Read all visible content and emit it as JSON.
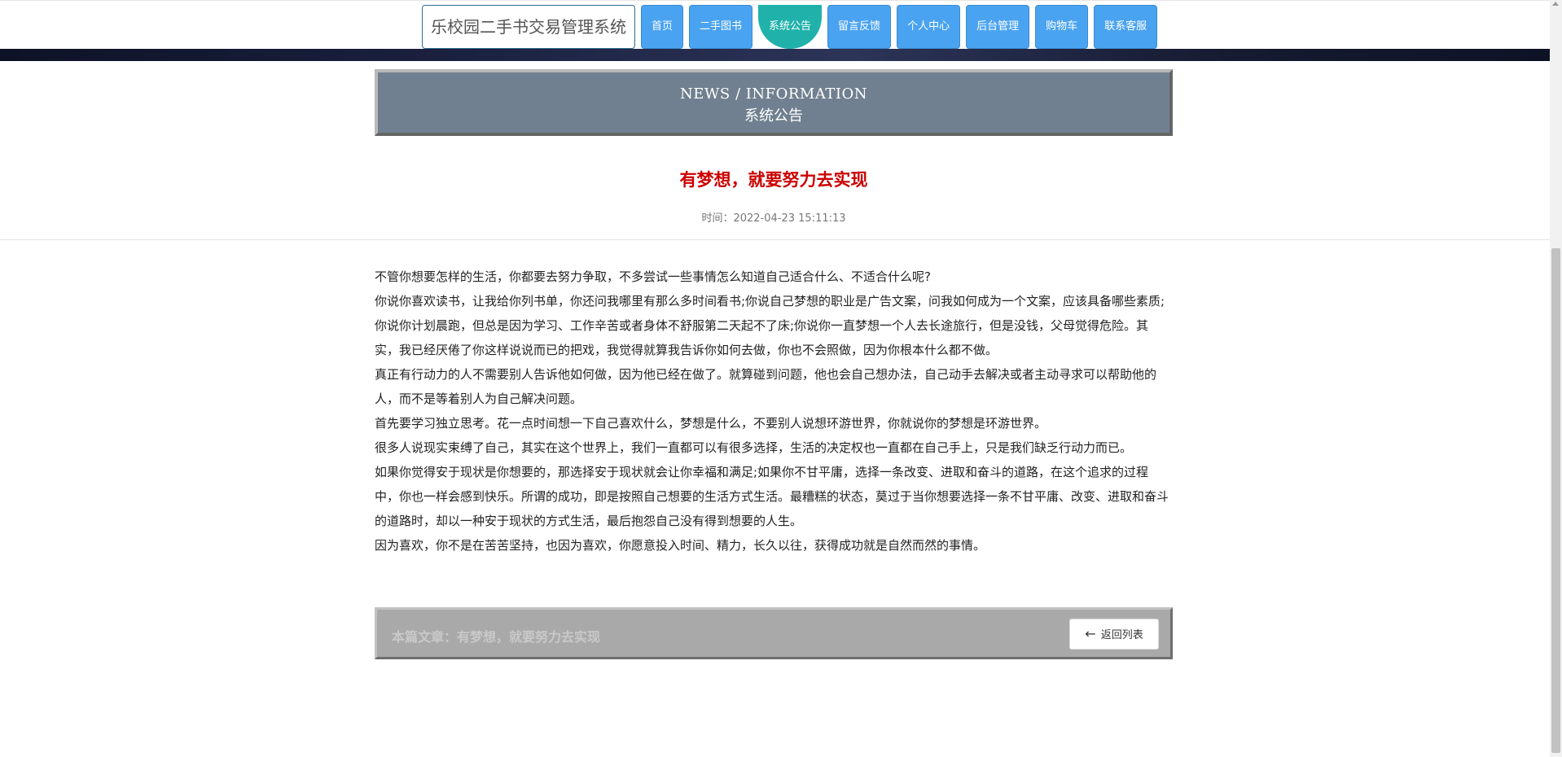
{
  "header": {
    "brand": "乐校园二手书交易管理系统",
    "nav": [
      {
        "label": "首页",
        "active": false
      },
      {
        "label": "二手图书",
        "active": false
      },
      {
        "label": "系统公告",
        "active": true
      },
      {
        "label": "留言反馈",
        "active": false
      },
      {
        "label": "个人中心",
        "active": false
      },
      {
        "label": "后台管理",
        "active": false
      },
      {
        "label": "购物车",
        "active": false
      },
      {
        "label": "联系客服",
        "active": false
      }
    ]
  },
  "banner": {
    "en": "NEWS / INFORMATION",
    "zh": "系统公告"
  },
  "article": {
    "title": "有梦想，就要努力去实现",
    "time_label": "时间：",
    "time": "2022-04-23 15:11:13",
    "paragraphs": [
      "不管你想要怎样的生活，你都要去努力争取，不多尝试一些事情怎么知道自己适合什么、不适合什么呢?",
      "你说你喜欢读书，让我给你列书单，你还问我哪里有那么多时间看书;你说自己梦想的职业是广告文案，问我如何成为一个文案，应该具备哪些素质;你说你计划晨跑，但总是因为学习、工作辛苦或者身体不舒服第二天起不了床;你说你一直梦想一个人去长途旅行，但是没钱，父母觉得危险。其实，我已经厌倦了你这样说说而已的把戏，我觉得就算我告诉你如何去做，你也不会照做，因为你根本什么都不做。",
      "真正有行动力的人不需要别人告诉他如何做，因为他已经在做了。就算碰到问题，他也会自己想办法，自己动手去解决或者主动寻求可以帮助他的人，而不是等着别人为自己解决问题。",
      "首先要学习独立思考。花一点时间想一下自己喜欢什么，梦想是什么，不要别人说想环游世界，你就说你的梦想是环游世界。",
      "很多人说现实束缚了自己，其实在这个世界上，我们一直都可以有很多选择，生活的决定权也一直都在自己手上，只是我们缺乏行动力而已。",
      "如果你觉得安于现状是你想要的，那选择安于现状就会让你幸福和满足;如果你不甘平庸，选择一条改变、进取和奋斗的道路，在这个追求的过程中，你也一样会感到快乐。所谓的成功，即是按照自己想要的生活方式生活。最糟糕的状态，莫过于当你想要选择一条不甘平庸、改变、进取和奋斗的道路时，却以一种安于现状的方式生活，最后抱怨自己没有得到想要的人生。",
      "因为喜欢，你不是在苦苦坚持，也因为喜欢，你愿意投入时间、精力，长久以往，获得成功就是自然而然的事情。"
    ]
  },
  "footer_bar": {
    "current_label": "本篇文章：有梦想，就要努力去实现",
    "back_label": "返回列表",
    "back_icon": "arrow-left-icon"
  },
  "colors": {
    "nav_bg": "#4aa3f0",
    "nav_active": "#20b2aa",
    "banner_bg": "#708090",
    "title_red": "#cc0000"
  }
}
